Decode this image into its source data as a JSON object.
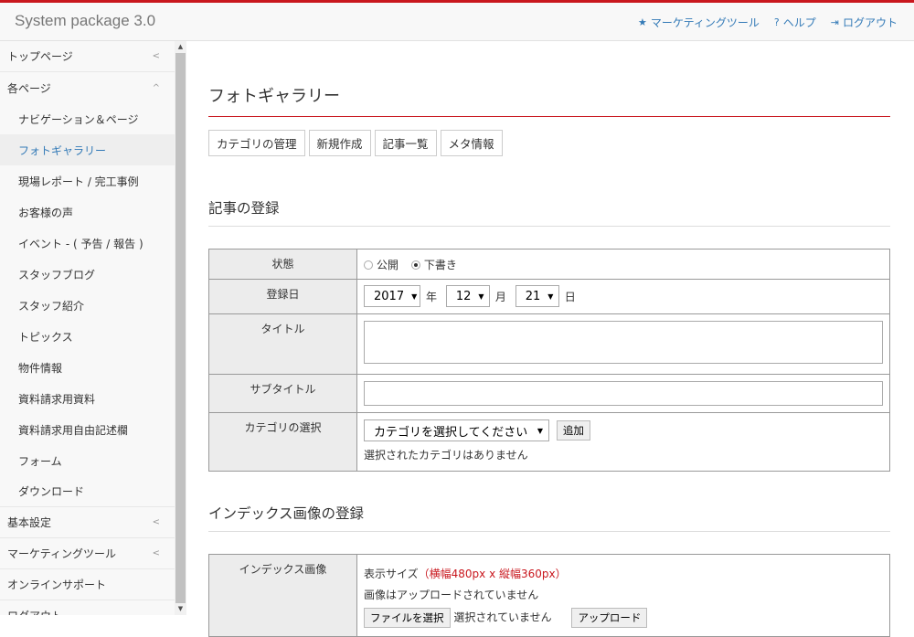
{
  "header": {
    "brand": "System package 3.0",
    "nav": [
      {
        "icon": "star-icon",
        "glyph": "★",
        "label": "マーケティングツール"
      },
      {
        "icon": "help-icon",
        "glyph": "?",
        "label": "ヘルプ"
      },
      {
        "icon": "logout-icon",
        "glyph": "⇥",
        "label": "ログアウト"
      }
    ]
  },
  "sidebar": {
    "top": {
      "label": "トップページ",
      "chev": "<"
    },
    "pages": {
      "label": "各ページ",
      "chev": "^"
    },
    "subitems": [
      "ナビゲーション＆ページ",
      "フォトギャラリー",
      "現場レポート / 完工事例",
      "お客様の声",
      "イベント - ( 予告 / 報告 )",
      "スタッフブログ",
      "スタッフ紹介",
      "トピックス",
      "物件情報",
      "資料請求用資料",
      "資料請求用自由記述欄",
      "フォーム",
      "ダウンロード"
    ],
    "basic": {
      "label": "基本設定",
      "chev": "<"
    },
    "marketing": {
      "label": "マーケティングツール",
      "chev": "<"
    },
    "support": {
      "label": "オンラインサポート"
    },
    "logout": {
      "label": "ログアウト"
    }
  },
  "main": {
    "title": "フォトギャラリー",
    "tabs": [
      "カテゴリの管理",
      "新規作成",
      "記事一覧",
      "メタ情報"
    ],
    "article_section": "記事の登録",
    "status": {
      "label": "状態",
      "options": [
        "公開",
        "下書き"
      ],
      "selected": "下書き"
    },
    "date": {
      "label": "登録日",
      "year": "2017",
      "year_unit": "年",
      "month": "12",
      "month_unit": "月",
      "day": "21",
      "day_unit": "日"
    },
    "title_field": {
      "label": "タイトル"
    },
    "subtitle_field": {
      "label": "サブタイトル"
    },
    "category": {
      "label": "カテゴリの選択",
      "placeholder": "カテゴリを選択してください",
      "add": "追加",
      "none": "選択されたカテゴリはありません"
    },
    "index_section": "インデックス画像の登録",
    "index_image": {
      "label": "インデックス画像",
      "size_label": "表示サイズ",
      "size_value": "（横幅480px x 縦幅360px）",
      "none": "画像はアップロードされていません",
      "choose": "ファイルを選択",
      "not_selected": "選択されていません",
      "upload": "アップロード"
    }
  }
}
